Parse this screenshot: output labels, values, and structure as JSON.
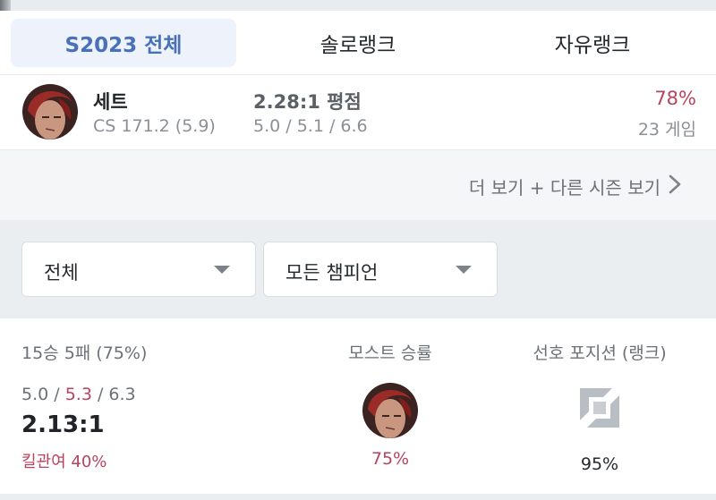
{
  "tabs": [
    {
      "label": "S2023 전체",
      "active": true
    },
    {
      "label": "솔로랭크",
      "active": false
    },
    {
      "label": "자유랭크",
      "active": false
    }
  ],
  "champion": {
    "name": "세트",
    "cs": "CS 171.2 (5.9)",
    "kda_ratio": "2.28:1 평점",
    "kda": "5.0 / 5.1 / 6.6",
    "winrate": "78%",
    "games": "23 게임"
  },
  "more_link": "더 보기 + 다른 시즌 보기",
  "filters": {
    "queue": "전체",
    "champion": "모든 챔피언"
  },
  "summary": {
    "record": "15승 5패 (75%)",
    "kills": "5.0",
    "deaths": "5.3",
    "assists": "6.3",
    "sep": " / ",
    "kda_ratio": "2.13:1",
    "kill_participation": "킬관여 40%",
    "most_winrate_title": "모스트 승률",
    "most_winrate_value": "75%",
    "position_title": "선호 포지션 (랭크)",
    "position_value": "95%"
  },
  "colors": {
    "accent": "#4a71b8",
    "win_red": "#b8435e",
    "muted": "#8a9096"
  },
  "icons": [
    "champion-portrait-icon",
    "chevron-right-icon",
    "dropdown-caret-icon",
    "position-jungle-icon"
  ]
}
